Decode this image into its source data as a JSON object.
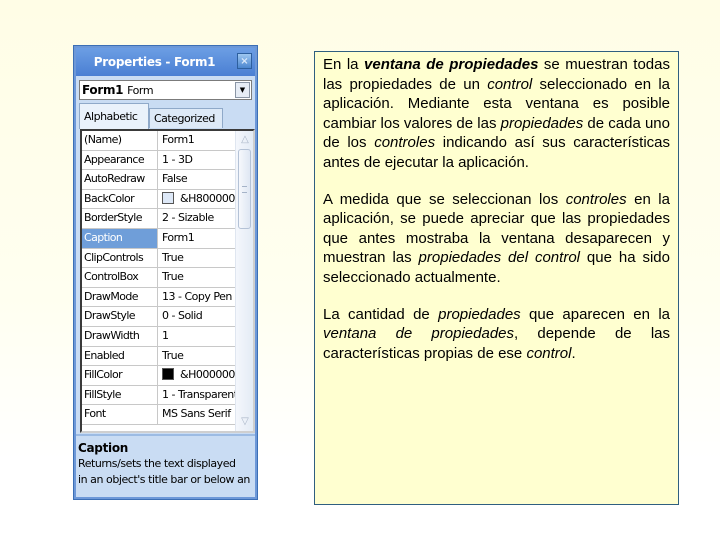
{
  "properties_window": {
    "title": "Properties - Form1",
    "close_icon": "close-icon",
    "object_selector": {
      "name": "Form1",
      "type": "Form",
      "dropdown_icon": "chevron-down-icon"
    },
    "tabs": [
      {
        "label": "Alphabetic",
        "active": true
      },
      {
        "label": "Categorized",
        "active": false
      }
    ],
    "selected_property": "Caption",
    "properties": [
      {
        "name": "(Name)",
        "value": "Form1"
      },
      {
        "name": "Appearance",
        "value": "1 - 3D"
      },
      {
        "name": "AutoRedraw",
        "value": "False"
      },
      {
        "name": "BackColor",
        "value": "&H800000",
        "swatch": "#dde8f7"
      },
      {
        "name": "BorderStyle",
        "value": "2 - Sizable"
      },
      {
        "name": "Caption",
        "value": "Form1"
      },
      {
        "name": "ClipControls",
        "value": "True"
      },
      {
        "name": "ControlBox",
        "value": "True"
      },
      {
        "name": "DrawMode",
        "value": "13 - Copy Pen"
      },
      {
        "name": "DrawStyle",
        "value": "0 - Solid"
      },
      {
        "name": "DrawWidth",
        "value": "1"
      },
      {
        "name": "Enabled",
        "value": "True"
      },
      {
        "name": "FillColor",
        "value": "&H000000",
        "swatch": "#000000"
      },
      {
        "name": "FillStyle",
        "value": "1 - Transparent"
      },
      {
        "name": "Font",
        "value": "MS Sans Serif"
      }
    ],
    "description": {
      "title": "Caption",
      "line1": "Returns/sets the text displayed",
      "line2": "in an object's title bar or below an"
    },
    "scrollbar": {
      "up_icon": "scroll-up-icon",
      "down_icon": "scroll-down-icon"
    }
  },
  "text_box": {
    "paragraphs": [
      [
        {
          "t": "En la "
        },
        {
          "t": "ventana de propiedades",
          "style": "bold-italic"
        },
        {
          "t": " se muestran todas las propiedades de un "
        },
        {
          "t": "control",
          "style": "italic"
        },
        {
          "t": " seleccionado en la aplicación. Mediante esta ventana es posible cambiar los valores de las "
        },
        {
          "t": "propiedades",
          "style": "italic"
        },
        {
          "t": " de cada uno de los "
        },
        {
          "t": "controles",
          "style": "italic"
        },
        {
          "t": " indicando así sus características antes de ejecutar la aplicación."
        }
      ],
      [
        {
          "t": "A medida que se seleccionan los "
        },
        {
          "t": "controles",
          "style": "italic"
        },
        {
          "t": " en la aplicación, se puede apreciar que las propiedades que antes mostraba la ventana desaparecen y muestran las "
        },
        {
          "t": "propiedades del control",
          "style": "italic"
        },
        {
          "t": " que ha sido seleccionado actualmente."
        }
      ],
      [
        {
          "t": "La cantidad de "
        },
        {
          "t": "propiedades",
          "style": "italic"
        },
        {
          "t": " que aparecen en la "
        },
        {
          "t": "ventana de propiedades",
          "style": "italic"
        },
        {
          "t": ", depende de las características propias de ese "
        },
        {
          "t": "control",
          "style": "italic"
        },
        {
          "t": "."
        }
      ]
    ]
  }
}
